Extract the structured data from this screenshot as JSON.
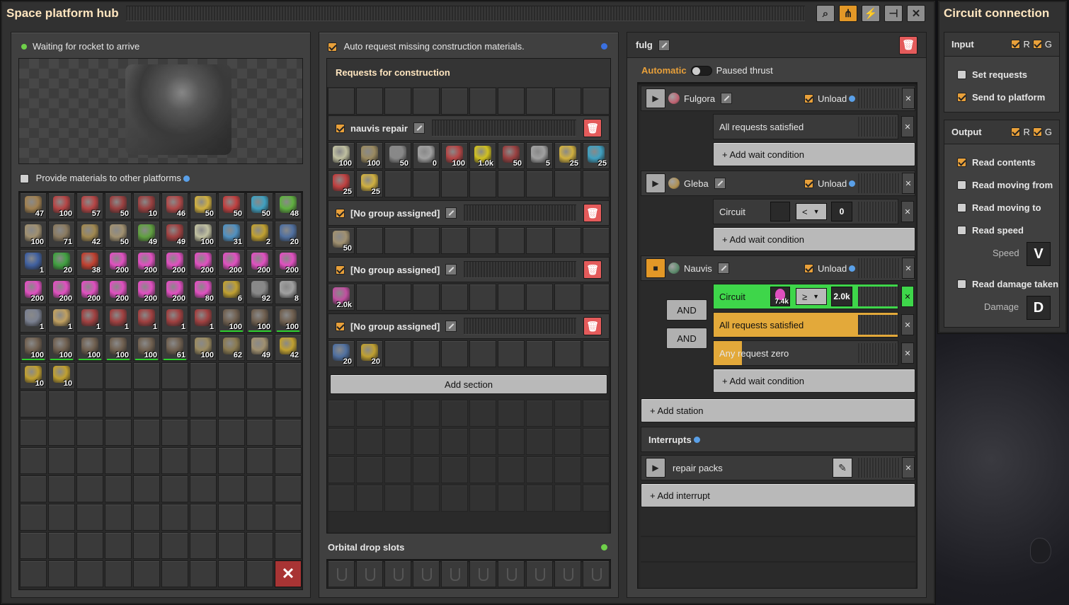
{
  "hub": {
    "title": "Space platform hub",
    "status": "Waiting for rocket to arrive",
    "provide_label": "Provide materials to other platforms",
    "inventory": [
      {
        "icon": "inserter-icon",
        "count": "47",
        "color": "#a08050"
      },
      {
        "icon": "belt-icon",
        "count": "100",
        "color": "#b54545"
      },
      {
        "icon": "belt-icon",
        "count": "57",
        "color": "#b54545"
      },
      {
        "icon": "gear-icon",
        "count": "50",
        "color": "#9a4040"
      },
      {
        "icon": "gear-icon",
        "count": "10",
        "color": "#9a4040"
      },
      {
        "icon": "splitter-icon",
        "count": "46",
        "color": "#b04848"
      },
      {
        "icon": "arm-icon",
        "count": "50",
        "color": "#d0b040"
      },
      {
        "icon": "arm-icon",
        "count": "50",
        "color": "#c04040"
      },
      {
        "icon": "arm-icon",
        "count": "50",
        "color": "#40a0c0"
      },
      {
        "icon": "arm-icon",
        "count": "48",
        "color": "#60b040"
      },
      {
        "icon": "tank-icon",
        "count": "100",
        "color": "#a09070"
      },
      {
        "icon": "pipe-icon",
        "count": "71",
        "color": "#8a7a60"
      },
      {
        "icon": "rock-icon",
        "count": "42",
        "color": "#a08850"
      },
      {
        "icon": "drill-icon",
        "count": "50",
        "color": "#a09070"
      },
      {
        "icon": "circuit-icon",
        "count": "49",
        "color": "#60a040"
      },
      {
        "icon": "wall-icon",
        "count": "49",
        "color": "#a04040"
      },
      {
        "icon": "repair-icon",
        "count": "100",
        "color": "#c0c0a0"
      },
      {
        "icon": "panel-icon",
        "count": "31",
        "color": "#5090c0"
      },
      {
        "icon": "module-icon",
        "count": "2",
        "color": "#c0a030"
      },
      {
        "icon": "turret-icon",
        "count": "20",
        "color": "#5070a0"
      },
      {
        "icon": "robot-icon",
        "count": "1",
        "color": "#4060a0"
      },
      {
        "icon": "battery-icon",
        "count": "20",
        "color": "#40a040"
      },
      {
        "icon": "ammo-icon",
        "count": "38",
        "color": "#c04030"
      },
      {
        "icon": "science-icon",
        "count": "200",
        "color": "#e050c0"
      },
      {
        "icon": "science-icon",
        "count": "200",
        "color": "#e050c0"
      },
      {
        "icon": "science-icon",
        "count": "200",
        "color": "#e050c0"
      },
      {
        "icon": "science-icon",
        "count": "200",
        "color": "#e050c0"
      },
      {
        "icon": "science-icon",
        "count": "200",
        "color": "#e050c0"
      },
      {
        "icon": "science-icon",
        "count": "200",
        "color": "#e050c0"
      },
      {
        "icon": "science-icon",
        "count": "200",
        "color": "#e050c0"
      },
      {
        "icon": "science-icon",
        "count": "200",
        "color": "#e050c0"
      },
      {
        "icon": "science-icon",
        "count": "200",
        "color": "#e050c0"
      },
      {
        "icon": "science-icon",
        "count": "200",
        "color": "#e050c0"
      },
      {
        "icon": "science-icon",
        "count": "200",
        "color": "#e050c0"
      },
      {
        "icon": "science-icon",
        "count": "200",
        "color": "#e050c0"
      },
      {
        "icon": "science-icon",
        "count": "200",
        "color": "#e050c0"
      },
      {
        "icon": "science-icon",
        "count": "80",
        "color": "#e050c0"
      },
      {
        "icon": "chest-icon",
        "count": "6",
        "color": "#c0a030"
      },
      {
        "icon": "ore-icon",
        "count": "92",
        "color": "#888888"
      },
      {
        "icon": "drone-icon",
        "count": "8",
        "color": "#a0a0a0"
      },
      {
        "icon": "grid-icon",
        "count": "1",
        "color": "#7a8090"
      },
      {
        "icon": "rocket-icon",
        "count": "1",
        "color": "#c0a060"
      },
      {
        "icon": "asteroid-icon",
        "count": "1",
        "color": "#a04040"
      },
      {
        "icon": "asteroid-icon",
        "count": "1",
        "color": "#a04040"
      },
      {
        "icon": "asteroid-icon",
        "count": "1",
        "color": "#a04040"
      },
      {
        "icon": "asteroid-icon",
        "count": "1",
        "color": "#a04040"
      },
      {
        "icon": "asteroid-icon",
        "count": "1",
        "color": "#a04040"
      },
      {
        "icon": "rail-icon",
        "count": "100",
        "color": "#706050"
      },
      {
        "icon": "rail-icon",
        "count": "100",
        "color": "#706050"
      },
      {
        "icon": "rail-icon",
        "count": "100",
        "color": "#706050"
      },
      {
        "icon": "rail-icon",
        "count": "100",
        "color": "#706050"
      },
      {
        "icon": "rail-icon",
        "count": "100",
        "color": "#706050"
      },
      {
        "icon": "rail-icon",
        "count": "100",
        "color": "#706050"
      },
      {
        "icon": "rail-icon",
        "count": "100",
        "color": "#706050"
      },
      {
        "icon": "rail-icon",
        "count": "100",
        "color": "#706050"
      },
      {
        "icon": "rail-icon",
        "count": "61",
        "color": "#706050"
      },
      {
        "icon": "foundation-icon",
        "count": "100",
        "color": "#9a8a60"
      },
      {
        "icon": "foundation-icon",
        "count": "62",
        "color": "#8a7a50"
      },
      {
        "icon": "crusher-icon",
        "count": "49",
        "color": "#a09070"
      },
      {
        "icon": "collector-icon",
        "count": "42",
        "color": "#c0a030"
      },
      {
        "icon": "thruster-icon",
        "count": "10",
        "color": "#c0a030"
      },
      {
        "icon": "thruster-icon",
        "count": "10",
        "color": "#c0a030"
      }
    ]
  },
  "construction": {
    "auto_label": "Auto request missing construction materials.",
    "requests_title": "Requests for construction",
    "sections": [
      {
        "name": "nauvis repair",
        "items": [
          {
            "icon": "repair-icon",
            "count": "100",
            "color": "#c0c0a0"
          },
          {
            "icon": "foundation-icon",
            "count": "100",
            "color": "#9a8a60"
          },
          {
            "icon": "ore-icon",
            "count": "50",
            "color": "#888888"
          },
          {
            "icon": "barrel-icon",
            "count": "0",
            "color": "#a0a0a0"
          },
          {
            "icon": "belt-icon",
            "count": "100",
            "color": "#b54545"
          },
          {
            "icon": "rail-icon",
            "count": "1.0k",
            "color": "#d0c020"
          },
          {
            "icon": "gear-icon",
            "count": "50",
            "color": "#9a4040"
          },
          {
            "icon": "drone-icon",
            "count": "5",
            "color": "#a0a0a0"
          },
          {
            "icon": "arm-icon",
            "count": "25",
            "color": "#d0b040"
          },
          {
            "icon": "arm-icon",
            "count": "25",
            "color": "#40a0c0"
          },
          {
            "icon": "arm-icon",
            "count": "25",
            "color": "#c04040"
          },
          {
            "icon": "arm-icon",
            "count": "25",
            "color": "#d0b040"
          }
        ]
      },
      {
        "name": "[No group assigned]",
        "items": [
          {
            "icon": "crusher-icon",
            "count": "50",
            "color": "#a09070"
          }
        ]
      },
      {
        "name": "[No group assigned]",
        "items": [
          {
            "icon": "science-icon",
            "count": "2.0k",
            "color": "#c050a0"
          }
        ]
      },
      {
        "name": "[No group assigned]",
        "items": [
          {
            "icon": "turret-icon",
            "count": "20",
            "color": "#5070a0"
          },
          {
            "icon": "thruster-icon",
            "count": "20",
            "color": "#c0a030"
          }
        ]
      }
    ],
    "add_section": "Add section",
    "orbital_title": "Orbital drop slots"
  },
  "schedule": {
    "name": "fulg",
    "automatic": "Automatic",
    "paused": "Paused thrust",
    "stations": [
      {
        "name": "Fulgora",
        "action": "Unload",
        "planet_color": "#c06070",
        "conditions": [
          {
            "text": "All requests satisfied"
          }
        ]
      },
      {
        "name": "Gleba",
        "action": "Unload",
        "planet_color": "#b09050",
        "conditions": [
          {
            "text": "Circuit",
            "op": "<",
            "value": "0"
          }
        ]
      },
      {
        "name": "Nauvis",
        "action": "Unload",
        "planet_color": "#5a8a6a",
        "conditions": [
          {
            "text": "Circuit",
            "op": "≥",
            "value": "2.0k",
            "signal": "7.4k"
          },
          {
            "text": "All requests satisfied"
          },
          {
            "text": "Any request zero"
          }
        ]
      }
    ],
    "add_wait": "+ Add wait condition",
    "and": "AND",
    "add_station": "+ Add station",
    "interrupts_title": "Interrupts",
    "interrupt": "repair packs",
    "add_interrupt": "+ Add interrupt"
  },
  "circuit": {
    "title": "Circuit connection",
    "input_title": "Input",
    "output_title": "Output",
    "r": "R",
    "g": "G",
    "set_requests": "Set requests",
    "send_to_platform": "Send to platform",
    "read_contents": "Read contents",
    "read_moving_from": "Read moving from",
    "read_moving_to": "Read moving to",
    "read_speed": "Read speed",
    "speed_label": "Speed",
    "speed_signal": "V",
    "read_damage": "Read damage taken",
    "damage_label": "Damage",
    "damage_signal": "D"
  },
  "colors": {
    "accent": "#e39827",
    "green": "#2fd12f",
    "delete": "#e45b5b",
    "title": "#ffe6c0"
  }
}
